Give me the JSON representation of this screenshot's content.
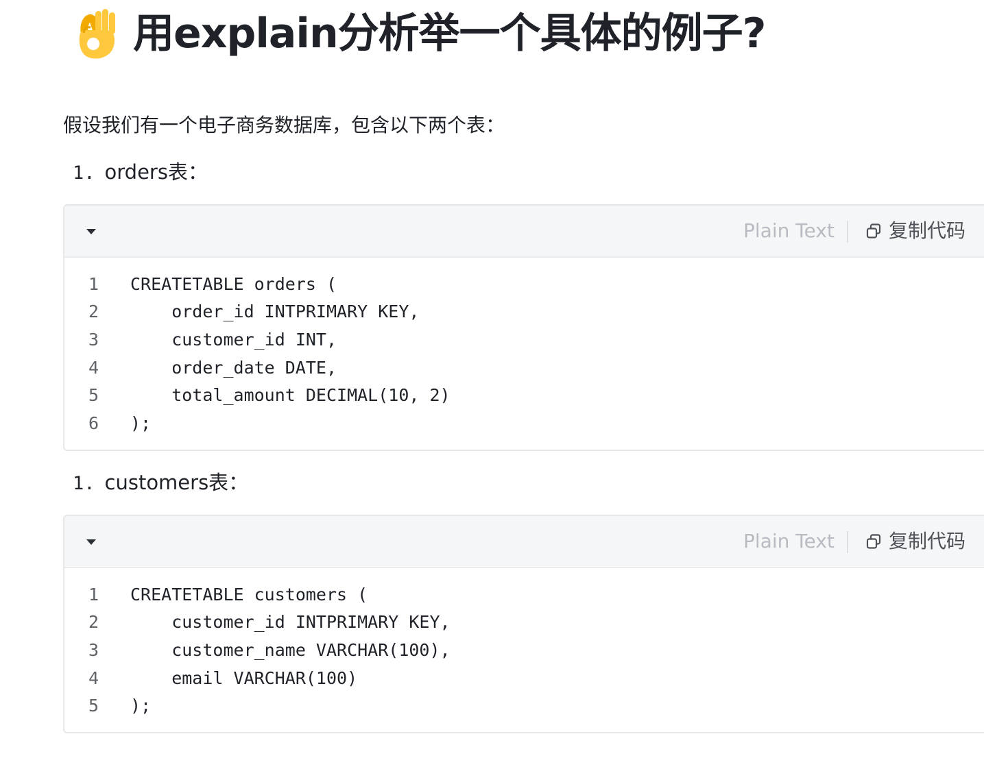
{
  "heading": {
    "emoji_icon": "ok-hand-icon",
    "text": "用explain分析举一个具体的例子?"
  },
  "intro": "假设我们有一个电子商务数据库，包含以下两个表：",
  "sections": [
    {
      "number": "1.",
      "label": "orders表：",
      "code_block": {
        "language": "Plain Text",
        "copy_label": "复制代码",
        "lines": [
          {
            "no": "1",
            "code": "CREATETABLE orders ("
          },
          {
            "no": "2",
            "code": "    order_id INTPRIMARY KEY,"
          },
          {
            "no": "3",
            "code": "    customer_id INT,"
          },
          {
            "no": "4",
            "code": "    order_date DATE,"
          },
          {
            "no": "5",
            "code": "    total_amount DECIMAL(10, 2)"
          },
          {
            "no": "6",
            "code": ");"
          }
        ]
      }
    },
    {
      "number": "1.",
      "label": "customers表：",
      "code_block": {
        "language": "Plain Text",
        "copy_label": "复制代码",
        "lines": [
          {
            "no": "1",
            "code": "CREATETABLE customers ("
          },
          {
            "no": "2",
            "code": "    customer_id INTPRIMARY KEY,"
          },
          {
            "no": "3",
            "code": "    customer_name VARCHAR(100),"
          },
          {
            "no": "4",
            "code": "    email VARCHAR(100)"
          },
          {
            "no": "5",
            "code": ");"
          }
        ]
      }
    }
  ],
  "colors": {
    "emoji_yellow": "#FFC83D",
    "header_bg": "#F5F6F7",
    "border": "#E6E7E9",
    "lang_label": "#B8BCC2"
  }
}
